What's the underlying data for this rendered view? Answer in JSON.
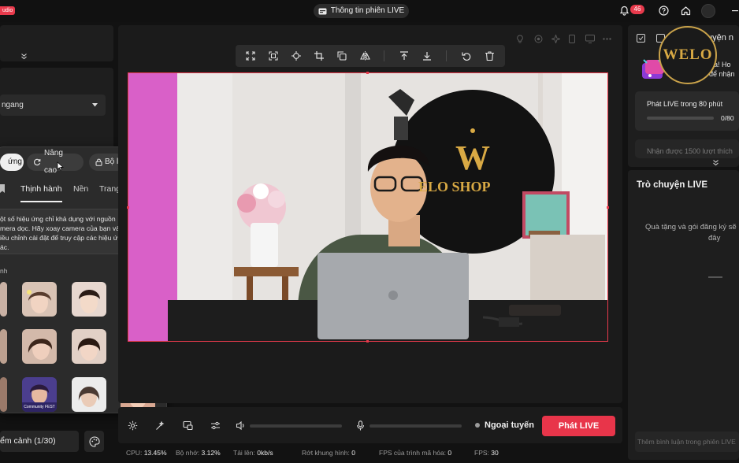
{
  "app": {
    "studio_badge": "udio",
    "session_title": "Thông tin phiên LIVE",
    "notification_count": "46"
  },
  "left_panel": {
    "orientation_value": "ngang",
    "scene_count": "ểm cảnh (1/30)"
  },
  "effects_popup": {
    "tabs": {
      "effects": "ứng",
      "advanced": "Nâng cao",
      "set": "Bộ lọc"
    },
    "subtabs": {
      "trending": "Thịnh hành",
      "background": "Nền",
      "makeup": "Trang điểm"
    },
    "notice_lines": [
      "ột số hiệu ứng chỉ khả dụng với nguồn",
      "mera dọc. Hãy xoay camera của bạn và",
      "iều chỉnh cài đặt để truy cập các hiệu ứng",
      "ác."
    ],
    "section_label": "nh",
    "thumb_caption": "Community FEST"
  },
  "video": {
    "shop_sign": "ELO SHOP"
  },
  "controls": {
    "status_text": "Ngoại tuyến",
    "golive_label": "Phát LIVE"
  },
  "stats": {
    "cpu_label": "CPU:",
    "cpu_value": "13.45%",
    "mem_label": "Bộ nhớ:",
    "mem_value": "3.12%",
    "upload_label": "Tải lên:",
    "upload_value": "0kb/s",
    "dropped_label": "Rớt khung hình:",
    "dropped_value": "0",
    "encoder_label": "FPS của trình mã hóa:",
    "encoder_value": "0",
    "fps_label": "FPS:",
    "fps_value": "30"
  },
  "right_panel": {
    "missions_title": "uyện n",
    "promo_line1": "ữa! Ho",
    "promo_line2": "để nhận",
    "mission1_title": "Phát LIVE trong 80 phút",
    "mission1_progress": "0/80",
    "mission1_fraction": 0,
    "mission2_title": "Nhận được 1500 lượt thích",
    "chat_title": "Trò chuyện LIVE",
    "chat_empty_line1": "Quà tặng và gói đăng ký sẽ",
    "chat_empty_line2": "đây",
    "chat_placeholder": "Thêm bình luận trong phiên LIVE",
    "watermark": "WELO"
  },
  "colors": {
    "accent": "#e8354a",
    "panel": "#1e1e1e",
    "background": "#121212",
    "gold": "#c9a24a"
  }
}
